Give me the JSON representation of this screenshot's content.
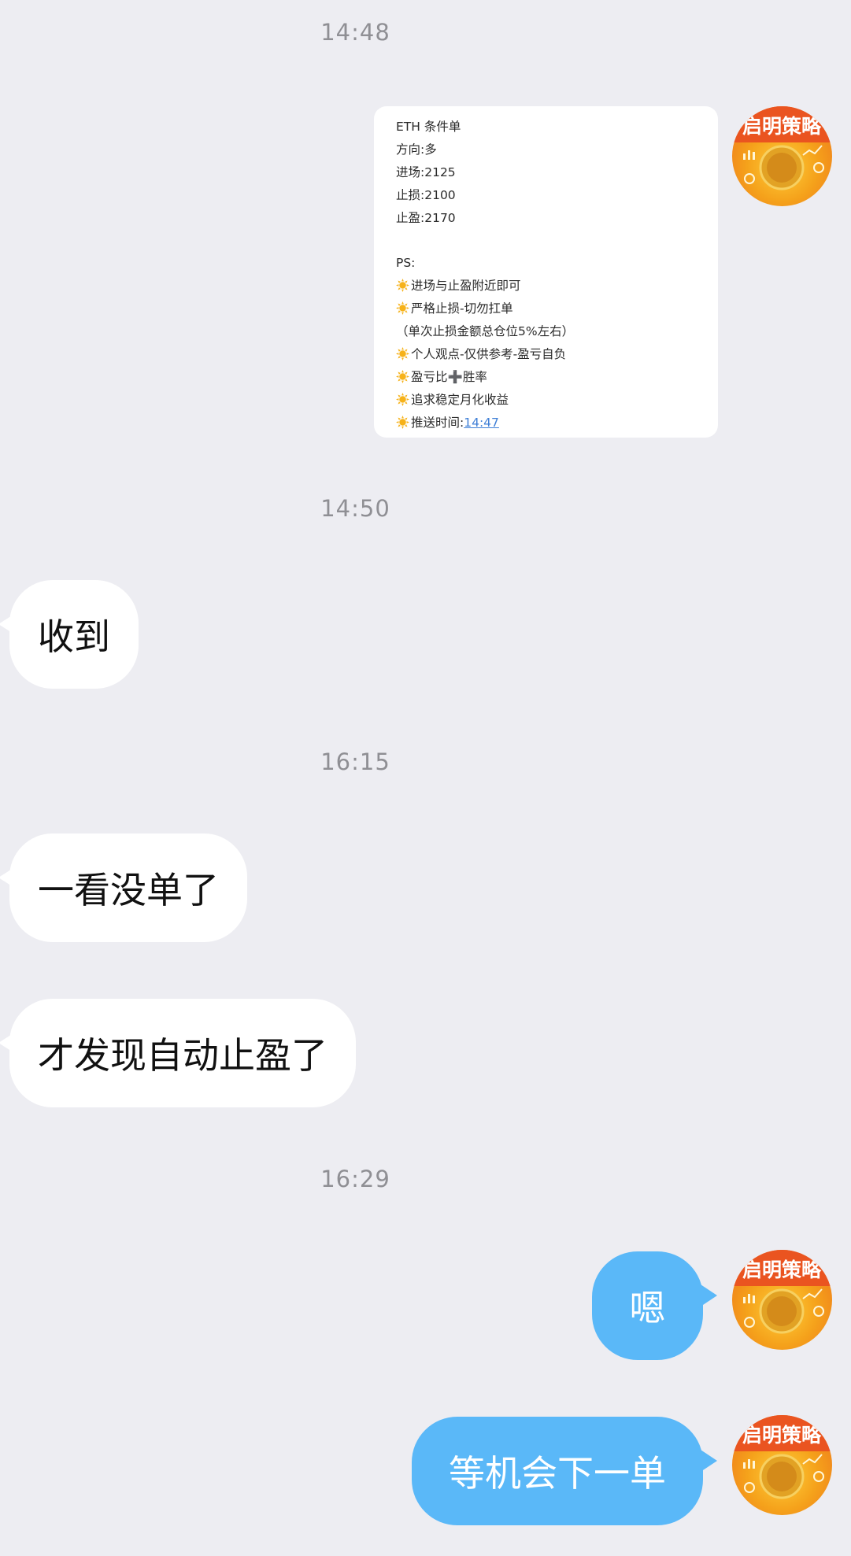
{
  "timestamps": [
    "14:48",
    "14:50",
    "16:15",
    "16:29"
  ],
  "avatar": {
    "label": "启明策略",
    "colors": {
      "top": "#ec5a20",
      "bottom": "#ffc52e"
    }
  },
  "strategy_card": {
    "title": "ETH 条件单",
    "direction": "方向:多",
    "entry": "进场:2125",
    "stop_loss": "止损:2100",
    "take_profit": "止盈:2170",
    "ps_label": "PS:",
    "notes": [
      "进场与止盈附近即可",
      "严格止损-切勿扛单"
    ],
    "note_sub": "（单次止损金额总仓位5%左右）",
    "notes2_a": "个人观点-仅供参考-盈亏自负",
    "notes2_b_pre": "盈亏比",
    "notes2_b_plus": "➕",
    "notes2_b_post": "胜率",
    "notes2_c": "追求稳定月化收益",
    "send_time_label": "推送时间:",
    "send_time_value": "14:47",
    "icon": "sun-emoji-icon"
  },
  "messages": {
    "in_1": "收到",
    "in_2": "一看没单了",
    "in_3": "才发现自动止盈了",
    "out_1": "嗯",
    "out_2": "等机会下一单"
  },
  "colors": {
    "background": "#ededf2",
    "incoming_bubble": "#ffffff",
    "outgoing_bubble": "#5ab8f8",
    "timestamp_text": "#8f8f94"
  }
}
